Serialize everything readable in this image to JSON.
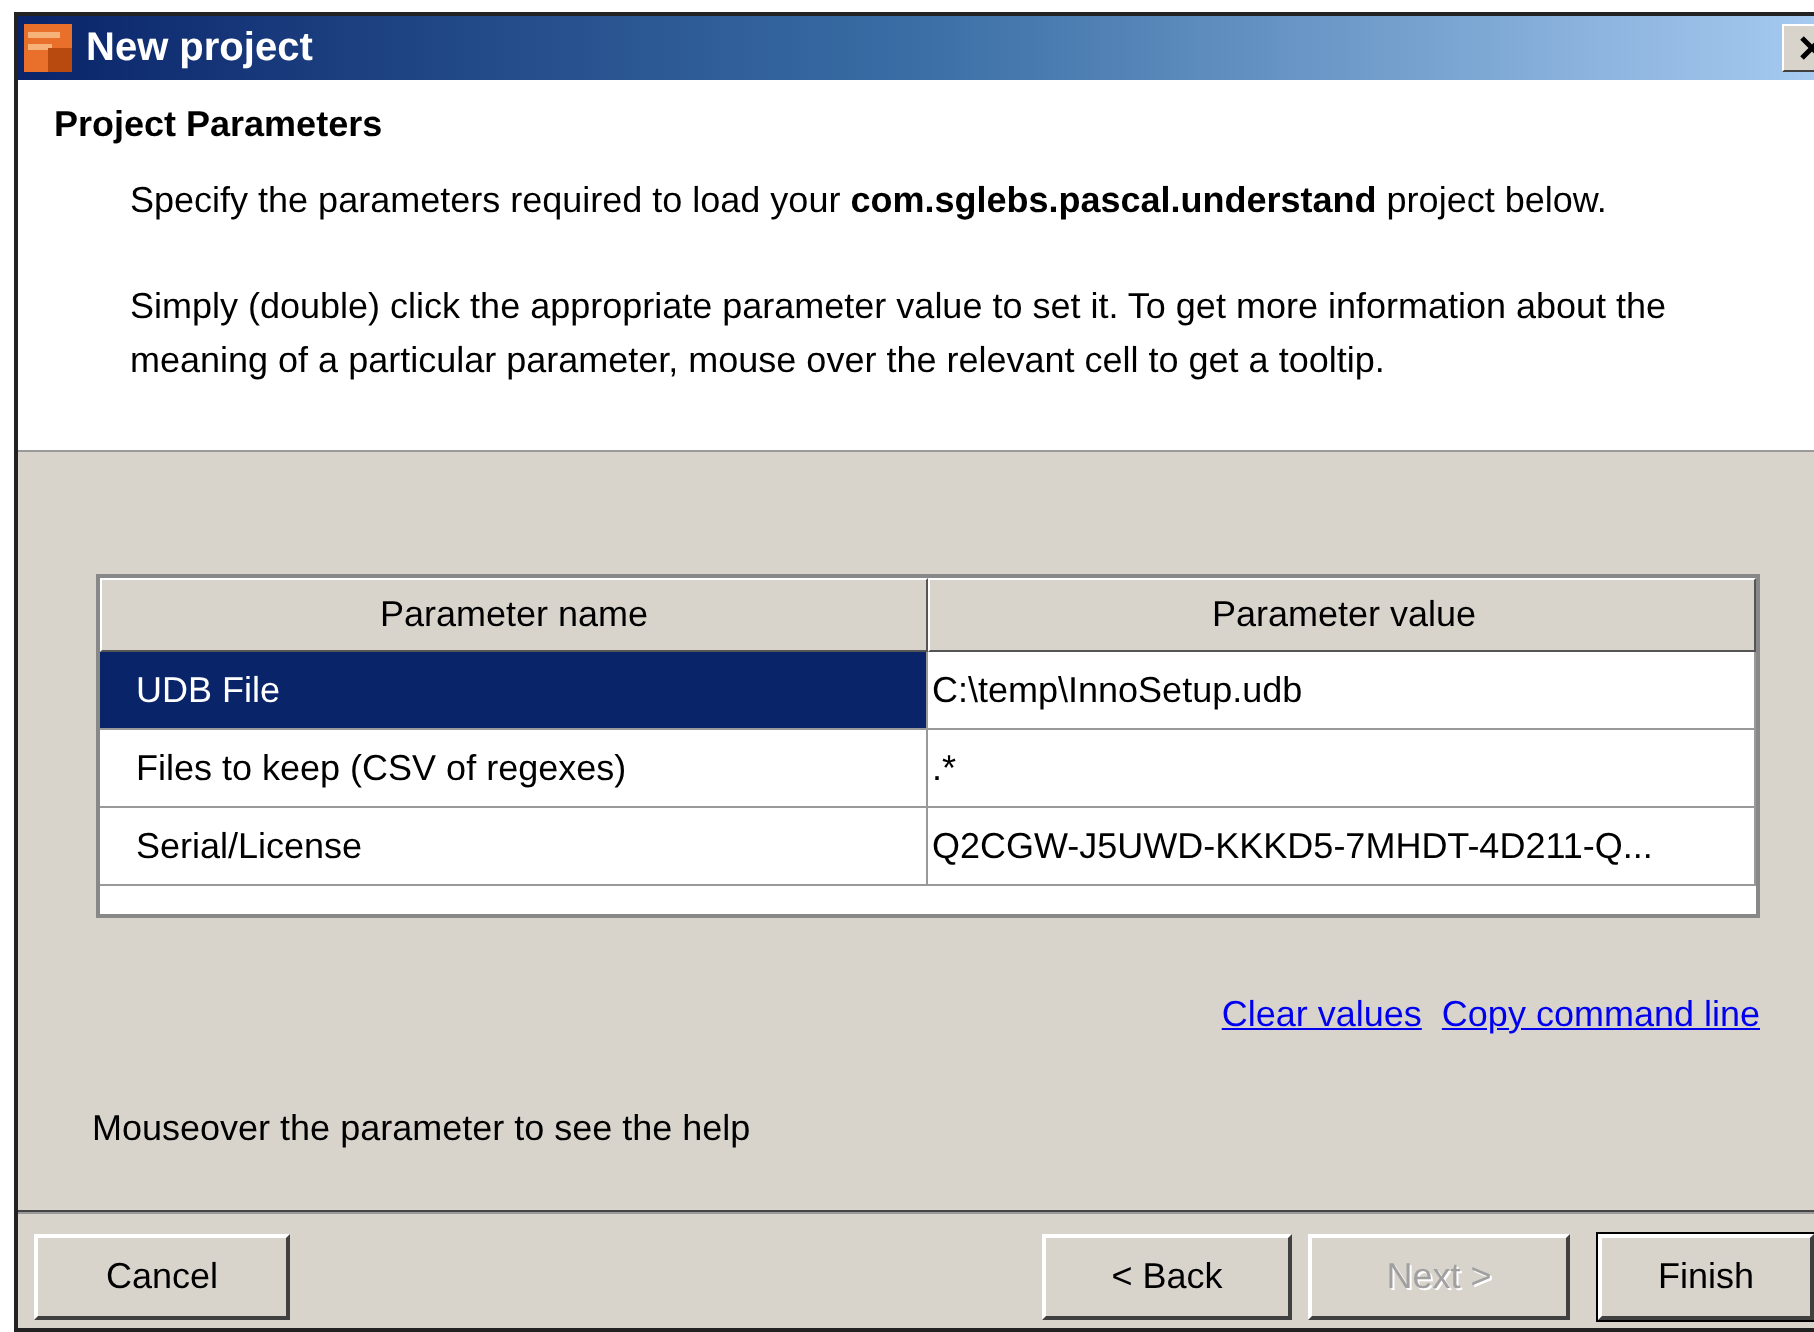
{
  "window": {
    "title": "New project"
  },
  "header": {
    "title": "Project Parameters",
    "paragraphs": [
      "Specify the parameters required to load your **com.sglebs.pascal.understand** project below.",
      "Simply (double) click the appropriate parameter value to set it. To get more information about the meaning of a particular parameter, mouse over the relevant cell to get a tooltip."
    ]
  },
  "table": {
    "columns": [
      "Parameter name",
      "Parameter value"
    ],
    "rows": [
      {
        "name": "UDB File",
        "value": "C:\\temp\\InnoSetup.udb",
        "selected": true
      },
      {
        "name": "Files to keep (CSV of regexes)",
        "value": ".*",
        "selected": false
      },
      {
        "name": "Serial/License",
        "value": "Q2CGW-J5UWD-KKKD5-7MHDT-4D211-Q...",
        "selected": false
      }
    ]
  },
  "links": [
    "Clear values",
    "Copy command line"
  ],
  "help_text": "Mouseover the parameter to see the help",
  "buttons": [
    {
      "label": "Cancel",
      "disabled": false,
      "default": false
    },
    {
      "label": "< Back",
      "disabled": false,
      "default": false
    },
    {
      "label": "Next >",
      "disabled": true,
      "default": false
    },
    {
      "label": "Finish",
      "disabled": false,
      "default": true
    }
  ]
}
